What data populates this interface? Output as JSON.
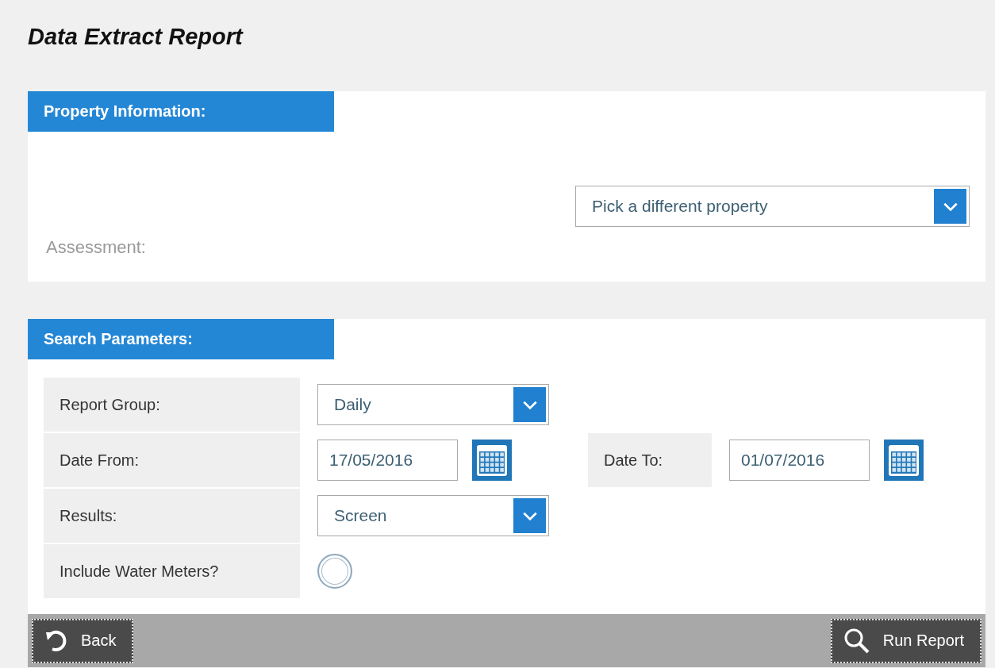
{
  "title": "Data Extract Report",
  "property_information": {
    "heading": "Property Information:",
    "property_picker": {
      "value": "Pick a different property"
    },
    "assessment_label": "Assessment:"
  },
  "search_parameters": {
    "heading": "Search Parameters:",
    "fields": [
      {
        "kind": "select",
        "label": "Report Group:",
        "value": "Daily"
      },
      {
        "kind": "date",
        "label": "Date From:",
        "value": "17/05/2016",
        "date_to": {
          "label": "Date To:",
          "value": "01/07/2016"
        }
      },
      {
        "kind": "select",
        "label": "Results:",
        "value": "Screen"
      },
      {
        "kind": "radio",
        "label": "Include Water Meters?",
        "checked": false
      }
    ]
  },
  "footer": {
    "buttons": [
      {
        "kind": "back",
        "label": "Back"
      },
      {
        "kind": "search",
        "label": "Run Report"
      }
    ]
  }
}
